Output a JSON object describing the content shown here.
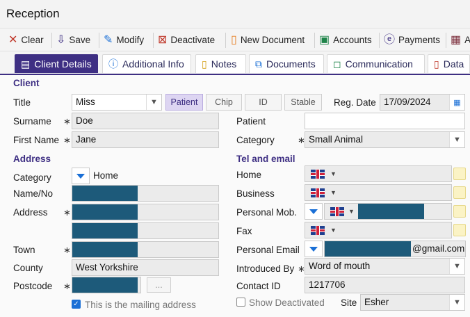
{
  "window": {
    "title": "Reception"
  },
  "toolbar": {
    "clear": "Clear",
    "save": "Save",
    "modify": "Modify",
    "deactivate": "Deactivate",
    "new_document": "New Document",
    "accounts": "Accounts",
    "payments": "Payments",
    "overflow": "A"
  },
  "tabs": {
    "client_details": "Client Details",
    "additional_info": "Additional Info",
    "notes": "Notes",
    "documents": "Documents",
    "communication": "Communication",
    "data": "Data"
  },
  "client": {
    "section": "Client",
    "title_label": "Title",
    "title_value": "Miss",
    "surname_label": "Surname",
    "surname_value": "Doe",
    "first_name_label": "First Name",
    "first_name_value": "Jane",
    "type_buttons": {
      "patient": "Patient",
      "chip": "Chip",
      "id": "ID",
      "stable": "Stable"
    },
    "reg_date_label": "Reg. Date",
    "reg_date_value": "17/09/2024",
    "patient_label": "Patient",
    "patient_value": "",
    "category_label": "Category",
    "category_value": "Small Animal"
  },
  "address": {
    "section": "Address",
    "category_label": "Category",
    "category_value": "Home",
    "name_no_label": "Name/No",
    "address_label": "Address",
    "town_label": "Town",
    "county_label": "County",
    "county_value": "West Yorkshire",
    "postcode_label": "Postcode",
    "postcode_lookup": "...",
    "mailing_label": "This is the mailing address"
  },
  "tel": {
    "section": "Tel and email",
    "home_label": "Home",
    "business_label": "Business",
    "personal_mob_label": "Personal Mob.",
    "fax_label": "Fax",
    "personal_email_label": "Personal Email",
    "email_domain": "@gmail.com",
    "introduced_by_label": "Introduced By",
    "introduced_by_value": "Word of mouth",
    "contact_id_label": "Contact ID",
    "contact_id_value": "1217706",
    "show_deactivated_label": "Show Deactivated",
    "site_label": "Site",
    "site_value": "Esher"
  },
  "required_mark": "∗",
  "colors": {
    "accent": "#3e2f83",
    "redaction": "#1d5a7a"
  }
}
